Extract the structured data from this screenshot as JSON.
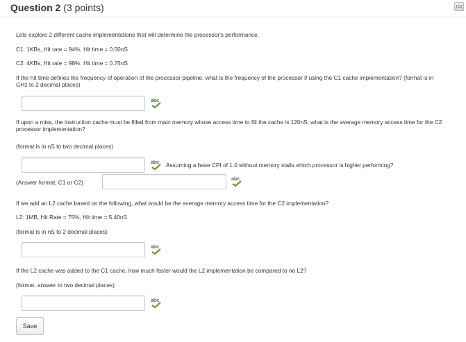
{
  "header": {
    "question_label": "Question 2",
    "points": "(3 points)"
  },
  "body": {
    "intro": "Lets explore 2 different cache implementations that will determine the processor's performance.",
    "c1": "C1:  1KBs, Hit rate = 94%, Hit time = 0.50nS",
    "c2": "C2:  4KBs, Hit rate = 98%. Hit time = 0.75nS",
    "q1": "If the hit time defines the frequency of operation of the processor pipeline, what is the frequency of the processor if using the C1 cache implementation? (format is in GHz to 2 decimal places)",
    "q2": "If upon a miss, the instruction cache must be filled from main memory whose access time to fill the cache is 120nS, what is the average memory access time for the C2 processor implementation?",
    "q2_format": "(format is in nS to two decimal places)",
    "q3": "Assuming a base CPI of 1.0 without memory stalls which processor is higher performing?",
    "q3_format": "(Answer format, C1 or C2)",
    "q4": "If we add an L2 cache based on the following, what would be the average memory access time for the C2 implementation?",
    "l2": "L2:  1MB, Hit Rate = 75%, Hit time = 5.40nS",
    "q4_format": "(format is in nS to 2 decimal places)",
    "q5": "If the L2 cache was added to the C1 cache, how much faster would the L2 implementation be compared to no L2?",
    "q5_format": "(format, answer to two decimal places)"
  },
  "answers": {
    "a1": "",
    "a2": "",
    "a3": "",
    "a4": "",
    "a5": ""
  },
  "spellcheck_label": "abc",
  "icons": {
    "spellcheck": "spellcheck-icon",
    "collapse": "collapse-icon"
  },
  "save_label": "Save",
  "colors": {
    "check_green": "#5aa02c",
    "border": "#c6c6c6"
  }
}
